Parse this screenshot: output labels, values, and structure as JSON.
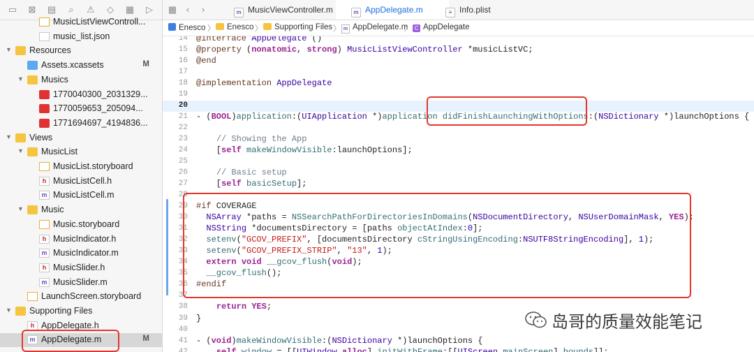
{
  "nav": {
    "items": [
      {
        "label": "MusicListViewControll...",
        "icon": "storyboard-file-icon",
        "kind": "file-sb",
        "depth": 3,
        "badge": ""
      },
      {
        "label": "music_list.json",
        "icon": "json-file-icon",
        "kind": "file-js",
        "depth": 3,
        "badge": ""
      },
      {
        "label": "Resources",
        "icon": "folder-icon",
        "kind": "folder",
        "depth": 1,
        "badge": "",
        "open": true
      },
      {
        "label": "Assets.xcassets",
        "icon": "asset-catalog-icon",
        "kind": "folder blue",
        "depth": 2,
        "badge": "M"
      },
      {
        "label": "Musics",
        "icon": "folder-icon",
        "kind": "folder",
        "depth": 2,
        "badge": "",
        "open": true
      },
      {
        "label": "1770040300_2031329...",
        "icon": "audio-file-icon",
        "kind": "file-red",
        "depth": 3,
        "badge": ""
      },
      {
        "label": "1770059653_205094...",
        "icon": "audio-file-icon",
        "kind": "file-red",
        "depth": 3,
        "badge": ""
      },
      {
        "label": "1771694697_4194836...",
        "icon": "audio-file-icon",
        "kind": "file-red",
        "depth": 3,
        "badge": ""
      },
      {
        "label": "Views",
        "icon": "folder-icon",
        "kind": "folder",
        "depth": 1,
        "badge": "",
        "open": true
      },
      {
        "label": "MusicList",
        "icon": "folder-icon",
        "kind": "folder",
        "depth": 2,
        "badge": "",
        "open": true
      },
      {
        "label": "MusicList.storyboard",
        "icon": "storyboard-file-icon",
        "kind": "file-sb",
        "depth": 3,
        "badge": ""
      },
      {
        "label": "MusicListCell.h",
        "icon": "header-file-icon",
        "kind": "file-h",
        "depth": 3,
        "badge": ""
      },
      {
        "label": "MusicListCell.m",
        "icon": "objc-file-icon",
        "kind": "file-m",
        "depth": 3,
        "badge": ""
      },
      {
        "label": "Music",
        "icon": "folder-icon",
        "kind": "folder",
        "depth": 2,
        "badge": "",
        "open": true
      },
      {
        "label": "Music.storyboard",
        "icon": "storyboard-file-icon",
        "kind": "file-sb",
        "depth": 3,
        "badge": ""
      },
      {
        "label": "MusicIndicator.h",
        "icon": "header-file-icon",
        "kind": "file-h",
        "depth": 3,
        "badge": ""
      },
      {
        "label": "MusicIndicator.m",
        "icon": "objc-file-icon",
        "kind": "file-m",
        "depth": 3,
        "badge": ""
      },
      {
        "label": "MusicSlider.h",
        "icon": "header-file-icon",
        "kind": "file-h",
        "depth": 3,
        "badge": ""
      },
      {
        "label": "MusicSlider.m",
        "icon": "objc-file-icon",
        "kind": "file-m",
        "depth": 3,
        "badge": ""
      },
      {
        "label": "LaunchScreen.storyboard",
        "icon": "storyboard-file-icon",
        "kind": "file-sb",
        "depth": 2,
        "badge": ""
      },
      {
        "label": "Supporting Files",
        "icon": "folder-icon",
        "kind": "folder",
        "depth": 1,
        "badge": "",
        "open": true
      },
      {
        "label": "AppDelegate.h",
        "icon": "header-file-icon",
        "kind": "file-h",
        "depth": 2,
        "badge": ""
      },
      {
        "label": "AppDelegate.m",
        "icon": "objc-file-icon",
        "kind": "file-m",
        "depth": 2,
        "badge": "M",
        "selected": true
      }
    ]
  },
  "tabs": [
    {
      "label": "MusicViewController.m",
      "icon": "m"
    },
    {
      "label": "AppDelegate.m",
      "icon": "m"
    },
    {
      "label": "Info.plist",
      "icon": "plist"
    }
  ],
  "breadcrumbs": [
    "Enesco",
    "Enesco",
    "Supporting Files",
    "AppDelegate.m",
    "AppDelegate"
  ],
  "code": {
    "current_line": "20",
    "lines": [
      {
        "n": "14",
        "t": "@interface AppDelegate ()"
      },
      {
        "n": "15",
        "t": "@property (nonatomic, strong) MusicListViewController *musicListVC;"
      },
      {
        "n": "16",
        "t": "@end"
      },
      {
        "n": "17",
        "t": ""
      },
      {
        "n": "18",
        "t": "@implementation AppDelegate"
      },
      {
        "n": "19",
        "t": ""
      },
      {
        "n": "20",
        "t": ""
      },
      {
        "n": "21",
        "t": "- (BOOL)application:(UIApplication *)application didFinishLaunchingWithOptions:(NSDictionary *)launchOptions {"
      },
      {
        "n": "22",
        "t": ""
      },
      {
        "n": "23",
        "t": "    // Showing the App"
      },
      {
        "n": "24",
        "t": "    [self makeWindowVisible:launchOptions];"
      },
      {
        "n": "25",
        "t": ""
      },
      {
        "n": "26",
        "t": "    // Basic setup"
      },
      {
        "n": "27",
        "t": "    [self basicSetup];"
      },
      {
        "n": "28",
        "t": ""
      },
      {
        "n": "29",
        "t": "#if COVERAGE"
      },
      {
        "n": "30",
        "t": "  NSArray *paths = NSSearchPathForDirectoriesInDomains(NSDocumentDirectory, NSUserDomainMask, YES);"
      },
      {
        "n": "31",
        "t": "  NSString *documentsDirectory = [paths objectAtIndex:0];"
      },
      {
        "n": "32",
        "t": "  setenv(\"GCOV_PREFIX\", [documentsDirectory cStringUsingEncoding:NSUTF8StringEncoding], 1);"
      },
      {
        "n": "33",
        "t": "  setenv(\"GCOV_PREFIX_STRIP\", \"13\", 1);"
      },
      {
        "n": "34",
        "t": "  extern void __gcov_flush(void);"
      },
      {
        "n": "35",
        "t": "  __gcov_flush();"
      },
      {
        "n": "36",
        "t": "#endif"
      },
      {
        "n": "37",
        "t": ""
      },
      {
        "n": "38",
        "t": "    return YES;"
      },
      {
        "n": "39",
        "t": "}"
      },
      {
        "n": "40",
        "t": ""
      },
      {
        "n": "41",
        "t": "- (void)makeWindowVisible:(NSDictionary *)launchOptions {"
      },
      {
        "n": "42",
        "t": "    self.window = [[UIWindow alloc] initWithFrame:[[UIScreen mainScreen] bounds]];"
      }
    ]
  },
  "watermark": {
    "text": "岛哥的质量效能笔记",
    "icon": "wechat-icon"
  },
  "colors": {
    "accent": "#1a6fe0",
    "highlight": "#e5352b",
    "gutter_change": "#6aa6f0"
  }
}
